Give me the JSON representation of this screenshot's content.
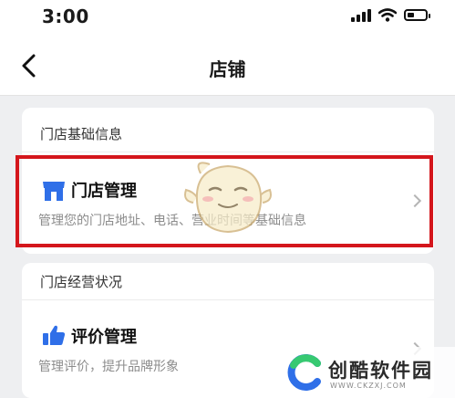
{
  "status_bar": {
    "time": "3:00"
  },
  "nav": {
    "title": "店铺"
  },
  "store_basic": {
    "section_label": "门店基础信息",
    "store_management": {
      "title": "门店管理",
      "description": "管理您的门店地址、电话、营业时间等基础信息"
    }
  },
  "store_operation": {
    "section_label": "门店经营状况",
    "review_management": {
      "title": "评价管理",
      "description": "管理评价，提升品牌形象"
    }
  },
  "watermark": {
    "name": "创酷软件园",
    "url": "WWW.CKZXJ.COM"
  },
  "colors": {
    "accent_blue": "#2f6fe8",
    "highlight_red": "#d4161c"
  }
}
